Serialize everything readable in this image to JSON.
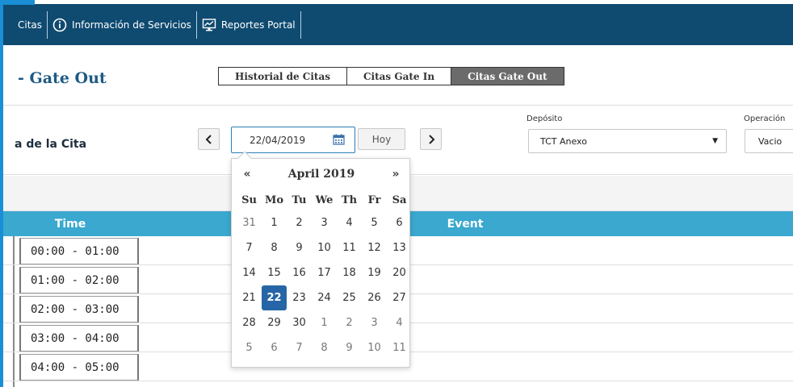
{
  "nav": {
    "items": [
      {
        "label": "Citas",
        "icon": ""
      },
      {
        "label": "Información de Servicios",
        "icon": "info-circle-icon"
      },
      {
        "label": "Reportes Portal",
        "icon": "monitor-chart-icon"
      }
    ]
  },
  "header": {
    "title": "- Gate Out",
    "tabs": [
      {
        "label": "Historial de Citas",
        "active": false
      },
      {
        "label": "Citas Gate In",
        "active": false
      },
      {
        "label": "Citas Gate Out",
        "active": true
      }
    ]
  },
  "filters": {
    "fecha_label": "a de la Cita",
    "date_value": "22/04/2019",
    "hoy_label": "Hoy",
    "deposito_label": "Depósito",
    "deposito_value": "TCT Anexo",
    "operacion_label": "Operación",
    "operacion_value": "Vacio"
  },
  "table": {
    "time_header": "Time",
    "event_header": "Event",
    "rows": [
      "00:00 - 01:00",
      "01:00 - 02:00",
      "02:00 - 03:00",
      "03:00 - 04:00",
      "04:00 - 05:00"
    ]
  },
  "datepicker": {
    "prev": "«",
    "next": "»",
    "title": "April 2019",
    "dow": [
      "Su",
      "Mo",
      "Tu",
      "We",
      "Th",
      "Fr",
      "Sa"
    ],
    "weeks": [
      [
        "31",
        "1",
        "2",
        "3",
        "4",
        "5",
        "6"
      ],
      [
        "7",
        "8",
        "9",
        "10",
        "11",
        "12",
        "13"
      ],
      [
        "14",
        "15",
        "16",
        "17",
        "18",
        "19",
        "20"
      ],
      [
        "21",
        "22",
        "23",
        "24",
        "25",
        "26",
        "27"
      ],
      [
        "28",
        "29",
        "30",
        "1",
        "2",
        "3",
        "4"
      ],
      [
        "5",
        "6",
        "7",
        "8",
        "9",
        "10",
        "11"
      ]
    ],
    "selected": "22"
  },
  "colors": {
    "navbar": "#0f4a70",
    "accent": "#1a8fd6",
    "table_header": "#3aa8cf",
    "selected_day": "#2766a6"
  }
}
